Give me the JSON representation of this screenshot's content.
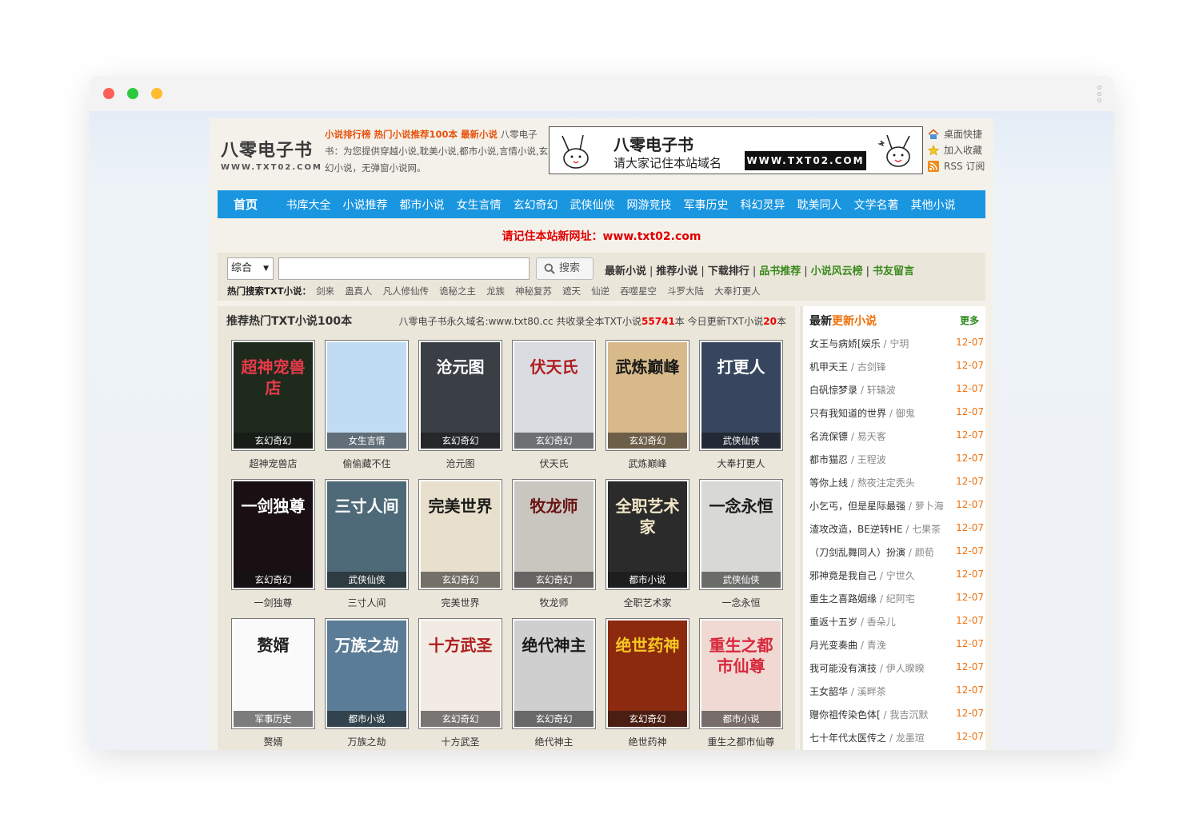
{
  "site": {
    "logo_cn": "八零电子书",
    "logo_en": "WWW.TXT02.COM",
    "intro_links": "小说排行榜 热门小说推荐100本 最新小说",
    "intro_text": " 八零电子书：为您提供穿越小说,耽美小说,都市小说,言情小说,玄幻小说，无弹窗小说网。",
    "banner_title": "八零电子书",
    "banner_sub": "请大家记住本站域名",
    "banner_domain": "WWW.TXT02.COM",
    "side_links": [
      {
        "label": "桌面快捷",
        "icon": "home-icon"
      },
      {
        "label": "加入收藏",
        "icon": "star-icon"
      },
      {
        "label": "RSS 订阅",
        "icon": "rss-icon"
      }
    ]
  },
  "nav": {
    "home": "首页",
    "items": [
      "书库大全",
      "小说推荐",
      "都市小说",
      "女生言情",
      "玄幻奇幻",
      "武侠仙侠",
      "网游竞技",
      "军事历史",
      "科幻灵异",
      "耽美同人",
      "文学名著",
      "其他小说"
    ]
  },
  "notice": "请记住本站新网址：www.txt02.com",
  "search": {
    "select_value": "综合",
    "input_value": "",
    "button": "搜索",
    "quick_links": [
      {
        "label": "最新小说",
        "green": false
      },
      {
        "label": "推荐小说",
        "green": false
      },
      {
        "label": "下载排行",
        "green": false
      },
      {
        "label": "品书推荐",
        "green": true
      },
      {
        "label": "小说风云榜",
        "green": true
      },
      {
        "label": "书友留言",
        "green": true
      }
    ],
    "hot_label": "热门搜索TXT小说：",
    "hot": [
      "剑来",
      "蛊真人",
      "凡人修仙传",
      "诡秘之主",
      "龙族",
      "神秘复苏",
      "遮天",
      "仙逆",
      "吞噬星空",
      "斗罗大陆",
      "大奉打更人"
    ]
  },
  "main": {
    "title": "推荐热门TXT小说100本",
    "stats_prefix": "八零电子书永久域名:www.txt80.cc 共收录全本TXT小说",
    "total": "55741",
    "stats_mid": "本 今日更新TXT小说",
    "today": "20",
    "stats_suffix": "本",
    "books": [
      {
        "name": "超神宠兽店",
        "cat": "玄幻奇幻",
        "cover_text": "超神宠兽店",
        "bg": "#1d2a1c",
        "fg": "#e83a4a"
      },
      {
        "name": "偷偷藏不住",
        "cat": "女生言情",
        "cover_text": "",
        "bg": "#bfdcf2",
        "fg": "#ffffff"
      },
      {
        "name": "沧元图",
        "cat": "玄幻奇幻",
        "cover_text": "沧元图",
        "bg": "#3a3f46",
        "fg": "#ffffff"
      },
      {
        "name": "伏天氏",
        "cat": "玄幻奇幻",
        "cover_text": "伏天氏",
        "bg": "#d9dde2",
        "fg": "#b01c1c"
      },
      {
        "name": "武炼巅峰",
        "cat": "玄幻奇幻",
        "cover_text": "武炼巅峰",
        "bg": "#d7b98a",
        "fg": "#1a1a1a"
      },
      {
        "name": "大奉打更人",
        "cat": "武侠仙侠",
        "cover_text": "打更人",
        "bg": "#37465e",
        "fg": "#ffffff"
      },
      {
        "name": "一剑独尊",
        "cat": "玄幻奇幻",
        "cover_text": "一剑独尊",
        "bg": "#1a1014",
        "fg": "#ffffff"
      },
      {
        "name": "三寸人间",
        "cat": "武侠仙侠",
        "cover_text": "三寸人间",
        "bg": "#4e6a78",
        "fg": "#ffffff"
      },
      {
        "name": "完美世界",
        "cat": "玄幻奇幻",
        "cover_text": "完美世界",
        "bg": "#e8e0cc",
        "fg": "#1a1a1a"
      },
      {
        "name": "牧龙师",
        "cat": "玄幻奇幻",
        "cover_text": "牧龙师",
        "bg": "#c9c6c0",
        "fg": "#6a1212"
      },
      {
        "name": "全职艺术家",
        "cat": "都市小说",
        "cover_text": "全职艺术家",
        "bg": "#2b2b2b",
        "fg": "#f0e6c8"
      },
      {
        "name": "一念永恒",
        "cat": "武侠仙侠",
        "cover_text": "一念永恒",
        "bg": "#d8d8d6",
        "fg": "#1a1a1a"
      },
      {
        "name": "赘婿",
        "cat": "军事历史",
        "cover_text": "赘婿",
        "bg": "#fafafa",
        "fg": "#222222"
      },
      {
        "name": "万族之劫",
        "cat": "都市小说",
        "cover_text": "万族之劫",
        "bg": "#5a7c96",
        "fg": "#ffffff"
      },
      {
        "name": "十方武圣",
        "cat": "玄幻奇幻",
        "cover_text": "十方武圣",
        "bg": "#f1ebe4",
        "fg": "#b01c1c"
      },
      {
        "name": "绝代神主",
        "cat": "玄幻奇幻",
        "cover_text": "绝代神主",
        "bg": "#cfcfcf",
        "fg": "#1a1a1a"
      },
      {
        "name": "绝世药神",
        "cat": "玄幻奇幻",
        "cover_text": "绝世药神",
        "bg": "#8c2a10",
        "fg": "#f5c623"
      },
      {
        "name": "重生之都市仙尊",
        "cat": "都市小说",
        "cover_text": "重生之都市仙尊",
        "bg": "#efd9d2",
        "fg": "#d8273c"
      }
    ]
  },
  "aside": {
    "title_a": "最新",
    "title_b": "更新小说",
    "more": "更多",
    "items": [
      {
        "title": "女王与病娇[娱乐",
        "author": "宁玥",
        "date": "12-07"
      },
      {
        "title": "机甲天王",
        "author": "古剑锋",
        "date": "12-07"
      },
      {
        "title": "白矾惊梦录",
        "author": "轩辕波",
        "date": "12-07"
      },
      {
        "title": "只有我知道的世界",
        "author": "御鬼",
        "date": "12-07"
      },
      {
        "title": "名流保镖",
        "author": "易天客",
        "date": "12-07"
      },
      {
        "title": "都市猫忍",
        "author": "王程波",
        "date": "12-07"
      },
      {
        "title": "等你上线",
        "author": "熬夜注定秃头",
        "date": "12-07"
      },
      {
        "title": "小乞丐，但是星际最强",
        "author": "萝卜海",
        "date": "12-07"
      },
      {
        "title": "渣攻改造，BE逆转HE",
        "author": "七果茶",
        "date": "12-07"
      },
      {
        "title": "（刀剑乱舞同人）扮演",
        "author": "颜荀",
        "date": "12-07"
      },
      {
        "title": "邪神竟是我自己",
        "author": "宁世久",
        "date": "12-07"
      },
      {
        "title": "重生之喜路姻缘",
        "author": "纪阿宅",
        "date": "12-07"
      },
      {
        "title": "重返十五岁",
        "author": "香朵儿",
        "date": "12-07"
      },
      {
        "title": "月光变奏曲",
        "author": "青浼",
        "date": "12-07"
      },
      {
        "title": "我可能没有演技",
        "author": "伊人睽睽",
        "date": "12-07"
      },
      {
        "title": "王女韶华",
        "author": "溪畔茶",
        "date": "12-07"
      },
      {
        "title": "赠你祖传染色体[",
        "author": "我吉沉默",
        "date": "12-07"
      },
      {
        "title": "七十年代太医传之",
        "author": "龙墨瑄",
        "date": "12-07"
      }
    ]
  }
}
